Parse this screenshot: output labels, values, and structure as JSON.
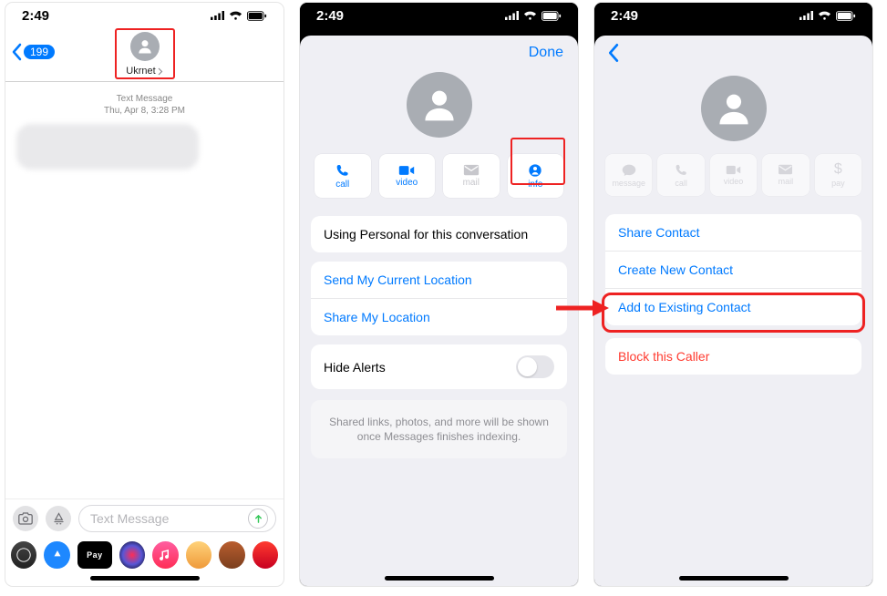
{
  "statusbar": {
    "time": "2:49"
  },
  "phone1": {
    "back_count": "199",
    "contact_name": "Ukrnet",
    "meta_line1": "Text Message",
    "meta_line2": "Thu, Apr 8, 3:28 PM",
    "composer_placeholder": "Text Message"
  },
  "phone2": {
    "done": "Done",
    "actions": {
      "call": "call",
      "video": "video",
      "mail": "mail",
      "info": "info"
    },
    "using_personal": "Using Personal for this conversation",
    "send_location": "Send My Current Location",
    "share_location": "Share My Location",
    "hide_alerts": "Hide Alerts",
    "indexing": "Shared links, photos, and more will be shown once Messages finishes indexing."
  },
  "phone3": {
    "actions": {
      "message": "message",
      "call": "call",
      "video": "video",
      "mail": "mail",
      "pay": "pay"
    },
    "share_contact": "Share Contact",
    "create_contact": "Create New Contact",
    "add_existing": "Add to Existing Contact",
    "block": "Block this Caller"
  }
}
